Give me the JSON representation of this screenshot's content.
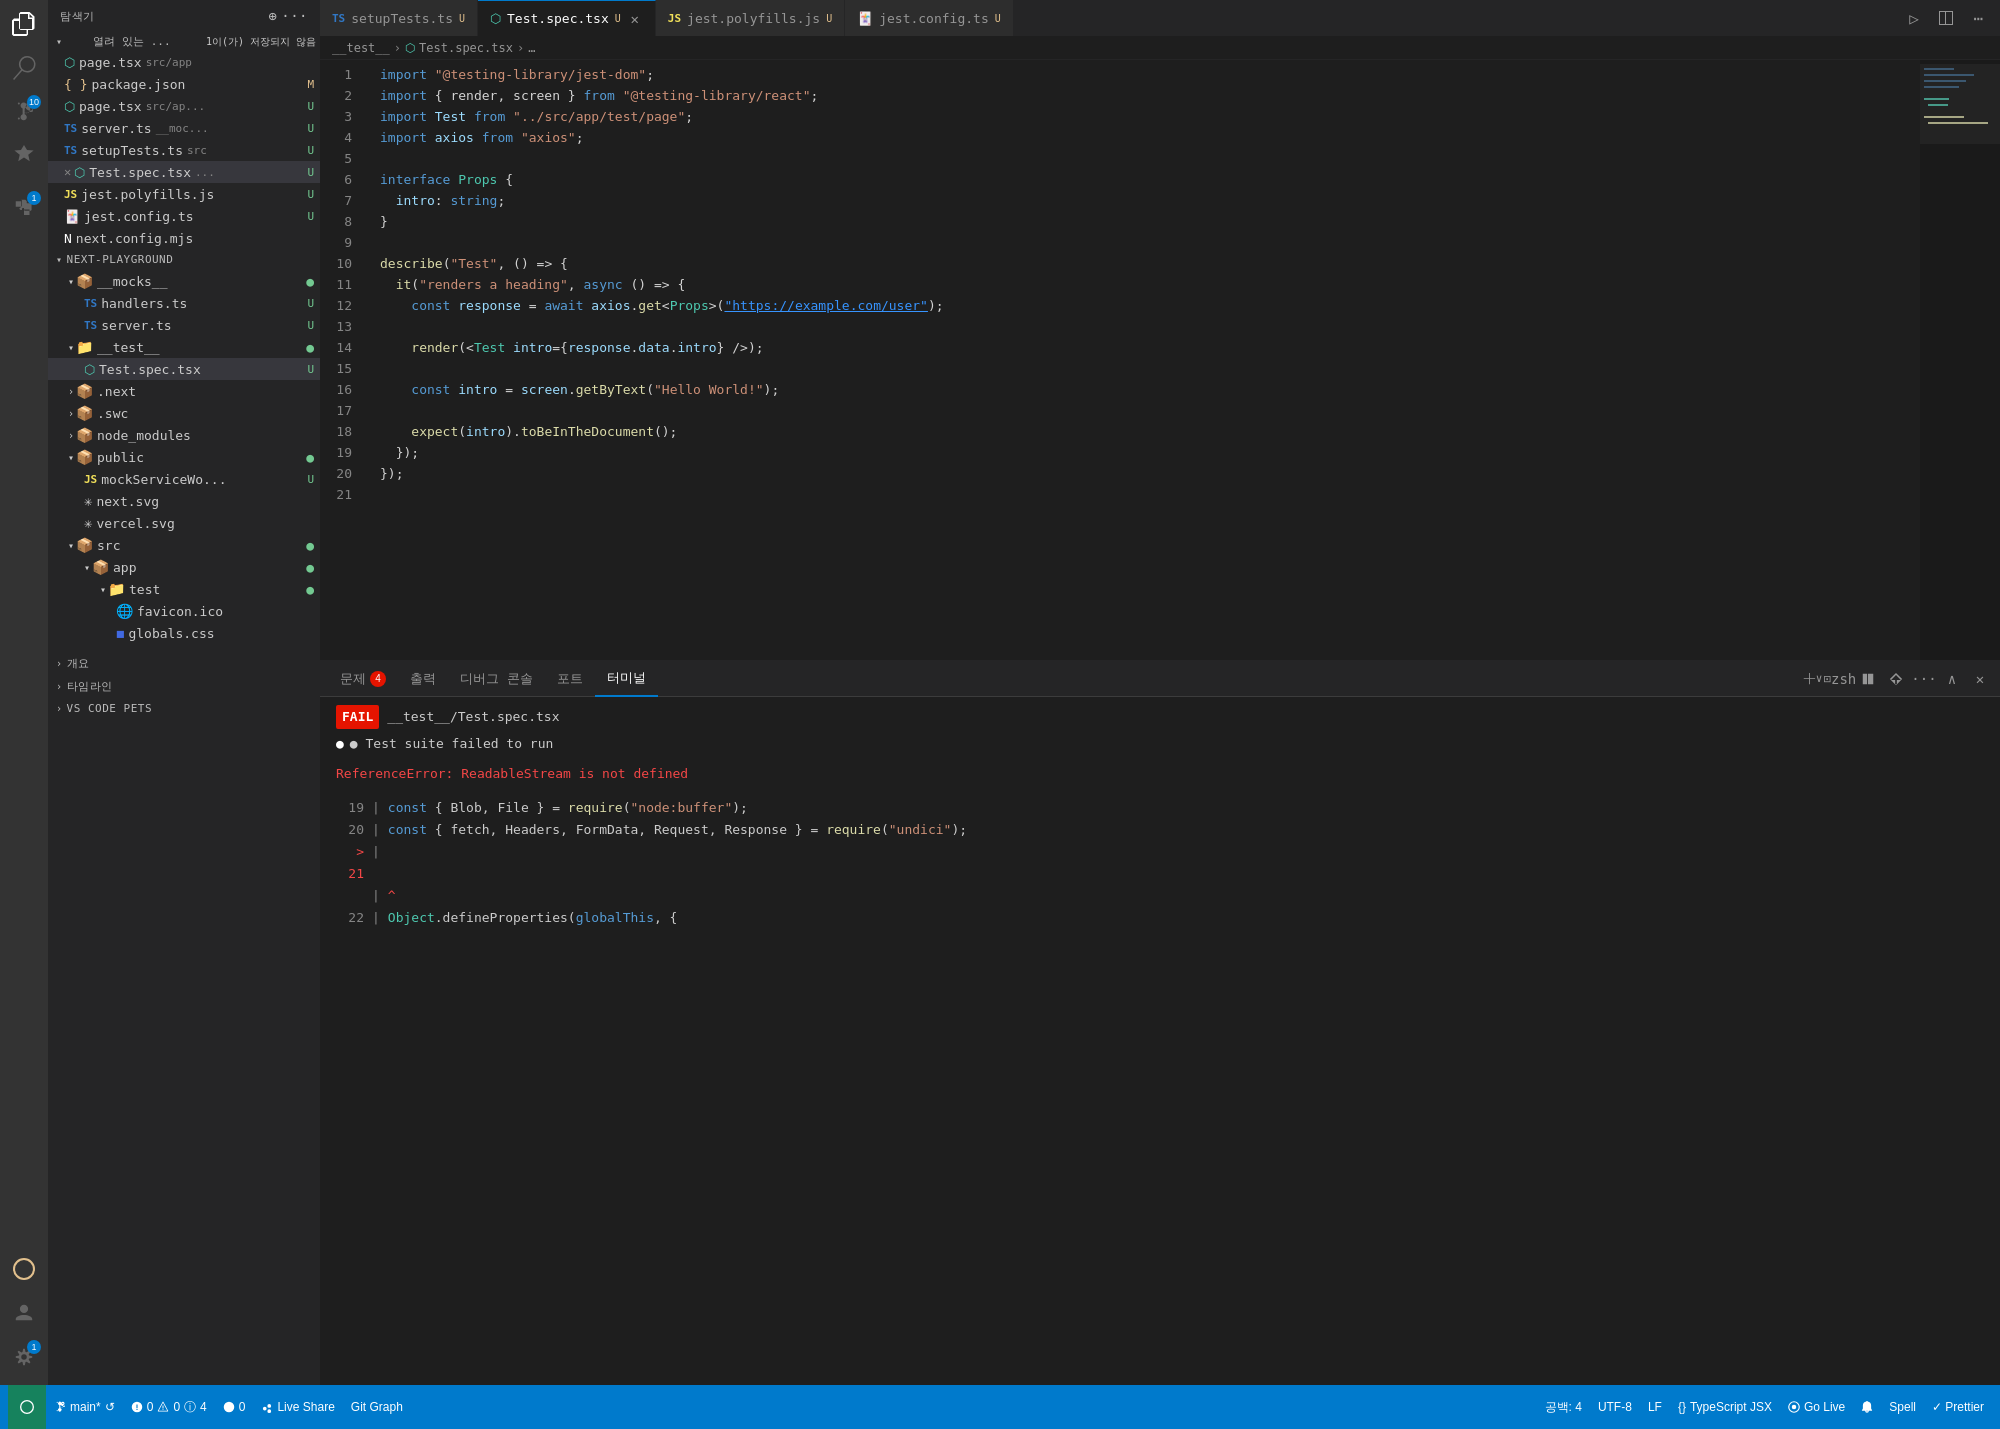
{
  "activity_bar": {
    "icons": [
      {
        "name": "explorer-icon",
        "symbol": "⎘",
        "active": true,
        "badge": null
      },
      {
        "name": "search-icon",
        "symbol": "🔍",
        "active": false,
        "badge": null
      },
      {
        "name": "source-control-icon",
        "symbol": "⑂",
        "active": false,
        "badge": "10"
      },
      {
        "name": "run-icon",
        "symbol": "▷",
        "active": false,
        "badge": null
      },
      {
        "name": "extensions-icon",
        "symbol": "⊞",
        "active": false,
        "badge": "1"
      }
    ],
    "bottom_icons": [
      {
        "name": "remote-icon",
        "symbol": "⊗",
        "active": false
      },
      {
        "name": "account-icon",
        "symbol": "👤",
        "active": false
      },
      {
        "name": "settings-icon",
        "symbol": "⚙",
        "active": false,
        "badge": "1"
      }
    ]
  },
  "sidebar": {
    "title": "탐색기",
    "open_files_label": "열려 있는 ...",
    "save_indicator": "1이(가) 저장되지 않음",
    "open_files": [
      {
        "name": "page.tsx",
        "path": "src/app",
        "icon": "tsx",
        "color": "#4ec9b0",
        "modified": null
      },
      {
        "name": "package.json",
        "path": "",
        "icon": "json",
        "color": "#e2c08d",
        "badge": "M"
      },
      {
        "name": "page.tsx",
        "path": "src/ap...",
        "icon": "tsx",
        "color": "#4ec9b0",
        "badge": "U"
      },
      {
        "name": "server.ts",
        "path": "__moc...",
        "icon": "ts",
        "color": "#3178c6",
        "badge": "U"
      },
      {
        "name": "setupTests.ts",
        "path": "src",
        "icon": "ts",
        "color": "#3178c6",
        "badge": "U"
      },
      {
        "name": "Test.spec.tsx",
        "path": "...",
        "icon": "spec-tsx",
        "color": "#4ec9b0",
        "badge": "U",
        "active": true
      },
      {
        "name": "jest.polyfills.js",
        "path": "",
        "icon": "js",
        "color": "#f1e05a",
        "badge": "U"
      },
      {
        "name": "jest.config.ts",
        "path": "",
        "icon": "jest",
        "color": "#c21325",
        "badge": "U"
      },
      {
        "name": "next.config.mjs",
        "path": "",
        "icon": "next",
        "color": "#ffffff"
      }
    ],
    "project_name": "NEXT-PLAYGROUND",
    "tree": [
      {
        "indent": 1,
        "type": "folder",
        "name": "__mocks__",
        "expanded": true,
        "dot": "green"
      },
      {
        "indent": 2,
        "type": "file",
        "name": "handlers.ts",
        "icon": "ts",
        "badge": "U"
      },
      {
        "indent": 2,
        "type": "file",
        "name": "server.ts",
        "icon": "ts",
        "badge": "U"
      },
      {
        "indent": 1,
        "type": "folder",
        "name": "__test__",
        "expanded": true,
        "dot": "green"
      },
      {
        "indent": 2,
        "type": "file",
        "name": "Test.spec.tsx",
        "icon": "spec-tsx",
        "active": true,
        "badge": "U"
      },
      {
        "indent": 1,
        "type": "folder",
        "name": ".next",
        "expanded": false
      },
      {
        "indent": 1,
        "type": "folder",
        "name": ".swc",
        "expanded": false
      },
      {
        "indent": 1,
        "type": "folder",
        "name": "node_modules",
        "expanded": false
      },
      {
        "indent": 1,
        "type": "folder",
        "name": "public",
        "expanded": true,
        "dot": "green"
      },
      {
        "indent": 2,
        "type": "file",
        "name": "mockServiceWo...",
        "icon": "js",
        "badge": "U"
      },
      {
        "indent": 2,
        "type": "file",
        "name": "next.svg",
        "icon": "svg"
      },
      {
        "indent": 2,
        "type": "file",
        "name": "vercel.svg",
        "icon": "svg"
      },
      {
        "indent": 1,
        "type": "folder",
        "name": "src",
        "expanded": true,
        "dot": "green"
      },
      {
        "indent": 2,
        "type": "folder",
        "name": "app",
        "expanded": true,
        "dot": "green"
      },
      {
        "indent": 3,
        "type": "folder",
        "name": "test",
        "expanded": true,
        "dot": "green"
      },
      {
        "indent": 4,
        "type": "file",
        "name": "favicon.ico",
        "icon": "ico"
      },
      {
        "indent": 4,
        "type": "file",
        "name": "globals.css",
        "icon": "css"
      }
    ],
    "bottom_sections": [
      {
        "name": "개요",
        "expanded": false
      },
      {
        "name": "타임라인",
        "expanded": false
      },
      {
        "name": "VS CODE PETS",
        "expanded": false
      }
    ]
  },
  "tabs": [
    {
      "label": "setupTests.ts",
      "icon": "ts",
      "modified": true,
      "active": false,
      "closeable": false
    },
    {
      "label": "Test.spec.tsx",
      "icon": "spec-tsx",
      "modified": true,
      "active": true,
      "closeable": true
    },
    {
      "label": "jest.polyfills.js",
      "icon": "js",
      "modified": true,
      "active": false,
      "closeable": false
    },
    {
      "label": "jest.config.ts",
      "icon": "jest",
      "modified": true,
      "active": false,
      "closeable": false
    }
  ],
  "breadcrumb": {
    "parts": [
      "__test__",
      "Test.spec.tsx",
      "..."
    ]
  },
  "editor": {
    "lines": [
      {
        "num": 1,
        "tokens": [
          {
            "t": "import ",
            "c": "kw"
          },
          {
            "t": "\"@testing-library/jest-dom\"",
            "c": "str"
          },
          {
            "t": ";",
            "c": "punct"
          }
        ]
      },
      {
        "num": 2,
        "tokens": [
          {
            "t": "import ",
            "c": "kw"
          },
          {
            "t": "{ render, screen } ",
            "c": "op"
          },
          {
            "t": "from ",
            "c": "kw"
          },
          {
            "t": "\"@testing-library/react\"",
            "c": "str"
          },
          {
            "t": ";",
            "c": "punct"
          }
        ]
      },
      {
        "num": 3,
        "tokens": [
          {
            "t": "import ",
            "c": "kw"
          },
          {
            "t": "Test ",
            "c": "var"
          },
          {
            "t": "from ",
            "c": "kw"
          },
          {
            "t": "\"../src/app/test/page\"",
            "c": "str"
          },
          {
            "t": ";",
            "c": "punct"
          }
        ]
      },
      {
        "num": 4,
        "tokens": [
          {
            "t": "import ",
            "c": "kw"
          },
          {
            "t": "axios ",
            "c": "var"
          },
          {
            "t": "from ",
            "c": "kw"
          },
          {
            "t": "\"axios\"",
            "c": "str"
          },
          {
            "t": ";",
            "c": "punct"
          }
        ]
      },
      {
        "num": 5,
        "tokens": []
      },
      {
        "num": 6,
        "tokens": [
          {
            "t": "interface ",
            "c": "kw"
          },
          {
            "t": "Props ",
            "c": "type"
          },
          {
            "t": "{",
            "c": "punct"
          }
        ]
      },
      {
        "num": 7,
        "tokens": [
          {
            "t": "  intro",
            "c": "prop"
          },
          {
            "t": ": ",
            "c": "punct"
          },
          {
            "t": "string",
            "c": "kw"
          },
          {
            "t": ";",
            "c": "punct"
          }
        ]
      },
      {
        "num": 8,
        "tokens": [
          {
            "t": "}",
            "c": "punct"
          }
        ]
      },
      {
        "num": 9,
        "tokens": []
      },
      {
        "num": 10,
        "tokens": [
          {
            "t": "describe",
            "c": "fn"
          },
          {
            "t": "(",
            "c": "punct"
          },
          {
            "t": "\"Test\"",
            "c": "str"
          },
          {
            "t": ", () => {",
            "c": "op"
          }
        ]
      },
      {
        "num": 11,
        "tokens": [
          {
            "t": "  ",
            "c": ""
          },
          {
            "t": "it",
            "c": "fn"
          },
          {
            "t": "(",
            "c": "punct"
          },
          {
            "t": "\"renders a heading\"",
            "c": "str"
          },
          {
            "t": ", ",
            "c": "op"
          },
          {
            "t": "async ",
            "c": "kw"
          },
          {
            "t": "() => {",
            "c": "op"
          }
        ]
      },
      {
        "num": 12,
        "tokens": [
          {
            "t": "    ",
            "c": ""
          },
          {
            "t": "const ",
            "c": "kw"
          },
          {
            "t": "response ",
            "c": "var"
          },
          {
            "t": "= ",
            "c": "op"
          },
          {
            "t": "await ",
            "c": "kw"
          },
          {
            "t": "axios",
            "c": "var"
          },
          {
            "t": ".",
            "c": "punct"
          },
          {
            "t": "get",
            "c": "fn"
          },
          {
            "t": "<",
            "c": "op"
          },
          {
            "t": "Props",
            "c": "type"
          },
          {
            "t": ">(",
            "c": "op"
          },
          {
            "t": "\"https://example.com/user\"",
            "c": "link"
          },
          {
            "t": ");",
            "c": "punct"
          }
        ]
      },
      {
        "num": 13,
        "tokens": []
      },
      {
        "num": 14,
        "tokens": [
          {
            "t": "    ",
            "c": ""
          },
          {
            "t": "render",
            "c": "fn"
          },
          {
            "t": "(<",
            "c": "punct"
          },
          {
            "t": "Test ",
            "c": "type"
          },
          {
            "t": "intro",
            "c": "prop"
          },
          {
            "t": "={",
            "c": "punct"
          },
          {
            "t": "response",
            "c": "var"
          },
          {
            "t": ".",
            "c": "punct"
          },
          {
            "t": "data",
            "c": "prop"
          },
          {
            "t": ".",
            "c": "punct"
          },
          {
            "t": "intro",
            "c": "prop"
          },
          {
            "t": "} />);",
            "c": "punct"
          }
        ]
      },
      {
        "num": 15,
        "tokens": []
      },
      {
        "num": 16,
        "tokens": [
          {
            "t": "    ",
            "c": ""
          },
          {
            "t": "const ",
            "c": "kw"
          },
          {
            "t": "intro ",
            "c": "var"
          },
          {
            "t": "= ",
            "c": "op"
          },
          {
            "t": "screen",
            "c": "var"
          },
          {
            "t": ".",
            "c": "punct"
          },
          {
            "t": "getByText",
            "c": "fn"
          },
          {
            "t": "(",
            "c": "punct"
          },
          {
            "t": "\"Hello World!\"",
            "c": "str"
          },
          {
            "t": ");",
            "c": "punct"
          }
        ]
      },
      {
        "num": 17,
        "tokens": []
      },
      {
        "num": 18,
        "tokens": [
          {
            "t": "    ",
            "c": ""
          },
          {
            "t": "expect",
            "c": "fn"
          },
          {
            "t": "(",
            "c": "punct"
          },
          {
            "t": "intro",
            "c": "var"
          },
          {
            "t": ").",
            "c": "punct"
          },
          {
            "t": "toBeInTheDocument",
            "c": "fn"
          },
          {
            "t": "();",
            "c": "punct"
          }
        ]
      },
      {
        "num": 19,
        "tokens": [
          {
            "t": "  });",
            "c": "punct"
          }
        ]
      },
      {
        "num": 20,
        "tokens": [
          {
            "t": "});",
            "c": "punct"
          }
        ]
      },
      {
        "num": 21,
        "tokens": []
      }
    ]
  },
  "panel": {
    "tabs": [
      {
        "label": "문제",
        "badge": "4"
      },
      {
        "label": "출력",
        "badge": null
      },
      {
        "label": "디버그 콘솔",
        "badge": null
      },
      {
        "label": "포트",
        "badge": null
      },
      {
        "label": "터미널",
        "badge": null,
        "active": true
      }
    ],
    "terminal_label": "zsh",
    "terminal_content": {
      "fail_badge": "FAIL",
      "fail_path": "__test__/Test.spec.tsx",
      "status_line": "● Test suite failed to run",
      "error_title": "ReferenceError: ReadableStream is not defined",
      "lines": [
        {
          "num": "19",
          "arrow": false,
          "code": [
            {
              "t": "const { Blob, File } = require(",
              "c": ""
            },
            {
              "t": "\"node:buffer\"",
              "c": "str"
            },
            {
              "t": ");",
              "c": ""
            }
          ]
        },
        {
          "num": "20",
          "arrow": false,
          "code": [
            {
              "t": "const { fetch, Headers, FormData, Request, Response } = require(",
              "c": ""
            },
            {
              "t": "\"undici\"",
              "c": "str"
            },
            {
              "t": ");",
              "c": ""
            }
          ]
        },
        {
          "num": "21",
          "arrow": true,
          "code": []
        },
        {
          "num": "",
          "arrow": false,
          "code": [
            {
              "t": "^",
              "c": ""
            }
          ]
        },
        {
          "num": "22",
          "arrow": false,
          "code": [
            {
              "t": "Object",
              "c": "type"
            },
            {
              "t": ".defineProperties(",
              "c": ""
            },
            {
              "t": "globalThis",
              "c": "kw"
            },
            {
              "t": ", {",
              "c": ""
            }
          ]
        }
      ]
    }
  },
  "status_bar": {
    "branch": "main*",
    "sync_icon": "↺",
    "errors": "0",
    "warnings": "0",
    "info": "4",
    "no_lint": "0",
    "live_share": "Live Share",
    "git_graph": "Git Graph",
    "spaces_label": "공백: 4",
    "encoding": "UTF-8",
    "line_ending": "LF",
    "language": "TypeScript JSX",
    "go_live": "Go Live",
    "spell": "Spell",
    "prettier": "✓ Prettier"
  }
}
